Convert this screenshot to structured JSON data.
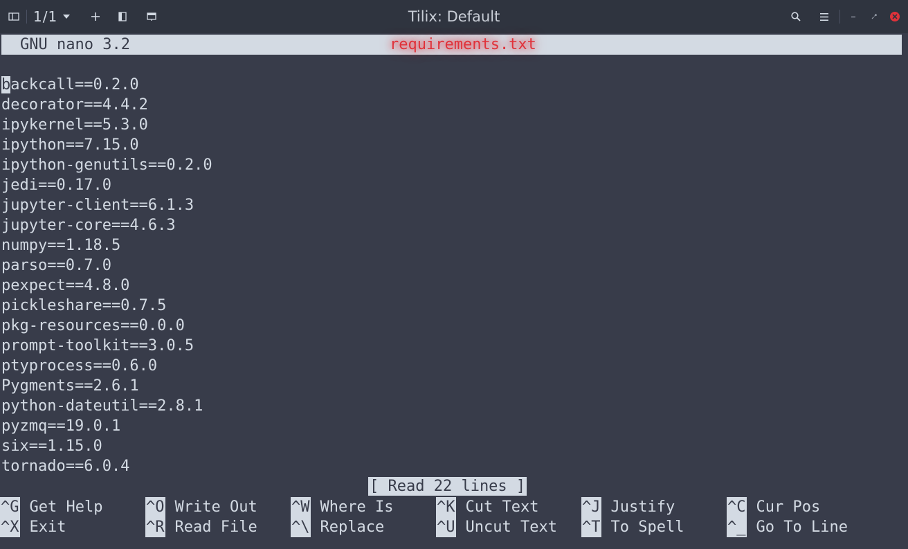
{
  "titlebar": {
    "session_label": "1/1",
    "title": "Tilix: Default"
  },
  "icons": {
    "sidebar": "sidebar-toggle-icon",
    "dropdown": "chevron-down-icon",
    "add": "plus-icon",
    "split_right": "split-horizontal-icon",
    "split_down": "split-vertical-icon",
    "search": "search-icon",
    "menu": "hamburger-menu-icon",
    "minimize": "minimize-icon",
    "maximize": "maximize-icon",
    "close": "close-icon"
  },
  "colors": {
    "titlebar_bg": "#2f343f",
    "terminal_bg": "#383c4a",
    "foreground": "#d3dae3",
    "close_accent": "#e0323a"
  },
  "nano": {
    "version": "GNU nano 3.2",
    "filename": "requirements.txt",
    "status": "[ Read 22 lines ]"
  },
  "editor": {
    "cursor_char": "b",
    "first_line_rest": "ackcall==0.2.0",
    "lines": [
      "decorator==4.4.2",
      "ipykernel==5.3.0",
      "ipython==7.15.0",
      "ipython-genutils==0.2.0",
      "jedi==0.17.0",
      "jupyter-client==6.1.3",
      "jupyter-core==4.6.3",
      "numpy==1.18.5",
      "parso==0.7.0",
      "pexpect==4.8.0",
      "pickleshare==0.7.5",
      "pkg-resources==0.0.0",
      "prompt-toolkit==3.0.5",
      "ptyprocess==0.6.0",
      "Pygments==2.6.1",
      "python-dateutil==2.8.1",
      "pyzmq==19.0.1",
      "six==1.15.0",
      "tornado==6.0.4"
    ]
  },
  "shortcuts": {
    "row1": [
      {
        "key": "^G",
        "label": "Get Help"
      },
      {
        "key": "^O",
        "label": "Write Out"
      },
      {
        "key": "^W",
        "label": "Where Is"
      },
      {
        "key": "^K",
        "label": "Cut Text"
      },
      {
        "key": "^J",
        "label": "Justify"
      },
      {
        "key": "^C",
        "label": "Cur Pos"
      }
    ],
    "row2": [
      {
        "key": "^X",
        "label": "Exit"
      },
      {
        "key": "^R",
        "label": "Read File"
      },
      {
        "key": "^\\",
        "label": "Replace"
      },
      {
        "key": "^U",
        "label": "Uncut Text"
      },
      {
        "key": "^T",
        "label": "To Spell"
      },
      {
        "key": "^_",
        "label": "Go To Line"
      }
    ]
  }
}
